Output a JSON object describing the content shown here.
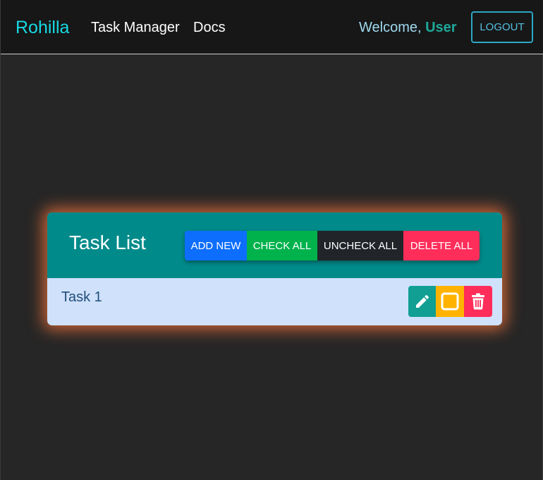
{
  "navbar": {
    "brand": "Rohilla",
    "links": [
      {
        "label": "Task Manager"
      },
      {
        "label": "Docs"
      }
    ],
    "welcome_prefix": "Welcome, ",
    "user_name": "User",
    "logout_label": "LOGOUT"
  },
  "task_list": {
    "title": "Task List",
    "buttons": {
      "add_new": "ADD NEW",
      "check_all": "CHECK ALL",
      "uncheck_all": "UNCHECK ALL",
      "delete_all": "DELETE ALL"
    },
    "tasks": [
      {
        "text": "Task 1",
        "checked": false,
        "actions": [
          "pencil-icon",
          "checkbox-empty-icon",
          "trash-icon"
        ]
      }
    ]
  },
  "colors": {
    "page_background": "#262626",
    "navbar_background": "#171717",
    "brand": "#17d9e3",
    "header_teal": "#018a8a",
    "task_row_background": "#d0e1fb",
    "card_glow": "#ff7a3c",
    "add_new": "#0d6efd",
    "check_all": "#00b24c",
    "uncheck_all": "#212529",
    "delete_all": "#ff2d5a",
    "edit": "#119f93",
    "toggle": "#ffb300",
    "trash": "#ff2d5a"
  }
}
